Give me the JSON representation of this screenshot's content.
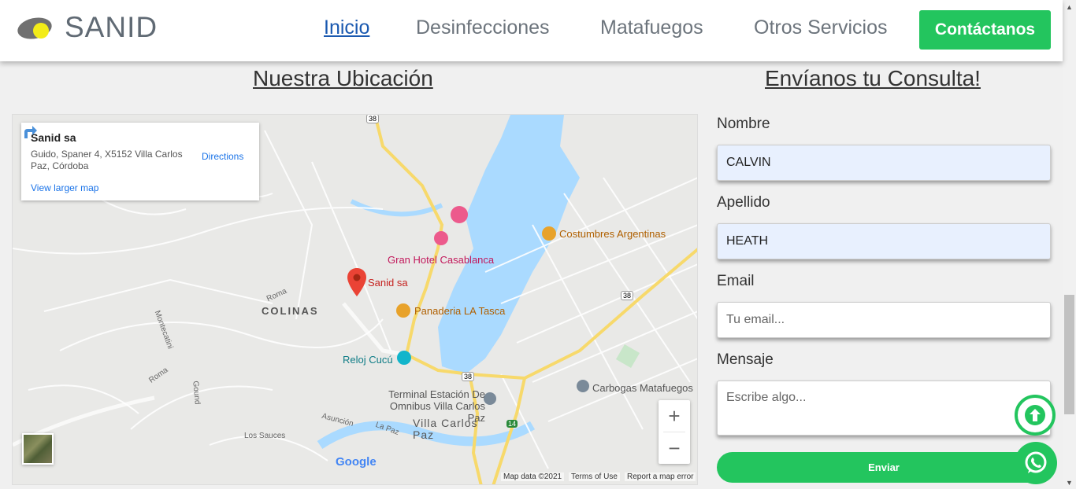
{
  "header": {
    "logo_text": "SANID",
    "nav": [
      {
        "label": "Inicio",
        "active": true
      },
      {
        "label": "Desinfecciones",
        "active": false
      },
      {
        "label": "Matafuegos",
        "active": false
      },
      {
        "label": "Otros Servicios",
        "active": false
      }
    ],
    "contact_button": "Contáctanos"
  },
  "location": {
    "title": "Nuestra Ubicación",
    "map": {
      "info_card": {
        "name": "Sanid sa",
        "address": "Guido, Spaner 4, X5152 Villa Carlos Paz, Córdoba",
        "view_larger": "View larger map",
        "directions": "Directions"
      },
      "places": {
        "sanid": "Sanid sa",
        "gran_hotel": "Gran Hotel Casablanca",
        "costumbres": "Costumbres Argentinas",
        "panaderia": "Panaderia LA Tasca",
        "reloj": "Reloj Cucú",
        "terminal": "Terminal Estación De Omnibus Villa Carlos Paz",
        "carbogas": "Carbogas Matafuegos",
        "colinas": "COLINAS",
        "villa": "Villa Carlos Paz",
        "roma1": "Roma",
        "roma2": "Roma",
        "montecatini": "Montecatini",
        "gounod": "Gound",
        "asuncion": "Asunción",
        "lapaz": "La Paz",
        "lossauces": "Los Sauces"
      },
      "route_shields": [
        "38",
        "38",
        "38",
        "14"
      ],
      "zoom_in": "+",
      "zoom_out": "−",
      "google": "Google",
      "footer": {
        "map_data": "Map data ©2021",
        "terms": "Terms of Use",
        "report": "Report a map error"
      }
    }
  },
  "form": {
    "title": "Envíanos tu Consulta!",
    "nombre_label": "Nombre",
    "nombre_value": "CALVIN",
    "apellido_label": "Apellido",
    "apellido_value": "HEATH",
    "email_label": "Email",
    "email_placeholder": "Tu email...",
    "mensaje_label": "Mensaje",
    "mensaje_placeholder": "Escribe algo...",
    "submit": "Enviar"
  },
  "colors": {
    "accent_green": "#23c55e",
    "active_link": "#1a59b0",
    "lake": "#aadaff"
  }
}
